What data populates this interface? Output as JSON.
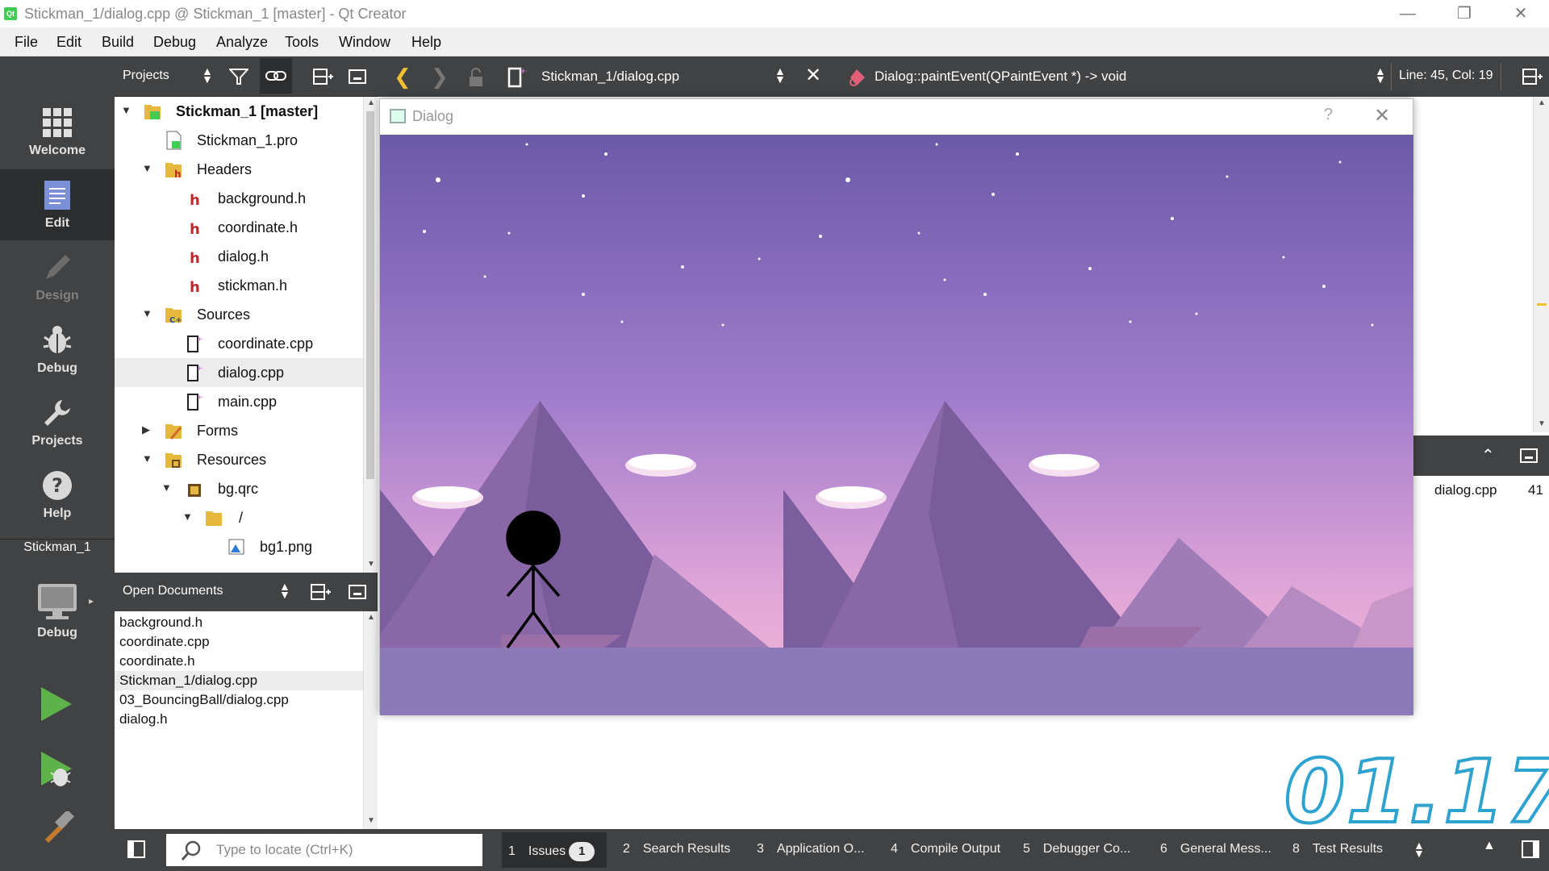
{
  "window": {
    "title": "Stickman_1/dialog.cpp @ Stickman_1 [master] - Qt Creator",
    "app_icon_text": "Qt"
  },
  "menu": [
    "File",
    "Edit",
    "Build",
    "Debug",
    "Analyze",
    "Tools",
    "Window",
    "Help"
  ],
  "modes": {
    "welcome": "Welcome",
    "edit": "Edit",
    "design": "Design",
    "debug": "Debug",
    "projects": "Projects",
    "help": "Help",
    "kit_project": "Stickman_1",
    "kit_build": "Debug"
  },
  "project_pane": {
    "selector": "Projects",
    "tree": [
      {
        "label": "Stickman_1 [master]",
        "icon": "qt-project-icon",
        "expanded": true
      },
      {
        "label": "Stickman_1.pro",
        "icon": "pro-file-icon"
      },
      {
        "label": "Headers",
        "icon": "headers-folder-icon",
        "expanded": true
      },
      {
        "label": "background.h",
        "icon": "header-file-icon"
      },
      {
        "label": "coordinate.h",
        "icon": "header-file-icon"
      },
      {
        "label": "dialog.h",
        "icon": "header-file-icon"
      },
      {
        "label": "stickman.h",
        "icon": "header-file-icon"
      },
      {
        "label": "Sources",
        "icon": "sources-folder-icon",
        "expanded": true
      },
      {
        "label": "coordinate.cpp",
        "icon": "cpp-file-icon"
      },
      {
        "label": "dialog.cpp",
        "icon": "cpp-file-icon",
        "selected": true
      },
      {
        "label": "main.cpp",
        "icon": "cpp-file-icon"
      },
      {
        "label": "Forms",
        "icon": "forms-folder-icon",
        "expanded": false
      },
      {
        "label": "Resources",
        "icon": "resources-folder-icon",
        "expanded": true
      },
      {
        "label": "bg.qrc",
        "icon": "qrc-file-icon",
        "expanded": true
      },
      {
        "label": "/",
        "icon": "folder-icon",
        "expanded": true
      },
      {
        "label": "bg1.png",
        "icon": "image-file-icon"
      }
    ]
  },
  "open_documents": {
    "selector": "Open Documents",
    "items": [
      "background.h",
      "coordinate.cpp",
      "coordinate.h",
      "Stickman_1/dialog.cpp",
      "03_BouncingBall/dialog.cpp",
      "dialog.h"
    ],
    "selected_index": 3
  },
  "editor_toolbar": {
    "file": "Stickman_1/dialog.cpp",
    "function": "Dialog::paintEvent(QPaintEvent *) -> void",
    "position": "Line: 45, Col: 19"
  },
  "right_pane": {
    "file": "dialog.cpp",
    "line": "41"
  },
  "dialog": {
    "title": "Dialog",
    "help": "?"
  },
  "locator": {
    "placeholder": "Type to locate (Ctrl+K)"
  },
  "output_tabs": [
    {
      "num": "1",
      "label": "Issues",
      "badge": "1"
    },
    {
      "num": "2",
      "label": "Search Results"
    },
    {
      "num": "3",
      "label": "Application O..."
    },
    {
      "num": "4",
      "label": "Compile Output"
    },
    {
      "num": "5",
      "label": "Debugger Co..."
    },
    {
      "num": "6",
      "label": "General Mess..."
    },
    {
      "num": "8",
      "label": "Test Results"
    }
  ],
  "overlay": {
    "timestamp": "01.17"
  },
  "colors": {
    "sidebar": "#404244",
    "sidebar_active": "#2c2d2f",
    "sky_top": "#6b5aa8",
    "sky_bottom": "#e6a8d8",
    "ground": "#8c79b8",
    "run_green": "#5db34a",
    "timestamp_stroke": "#2fa3cf"
  }
}
